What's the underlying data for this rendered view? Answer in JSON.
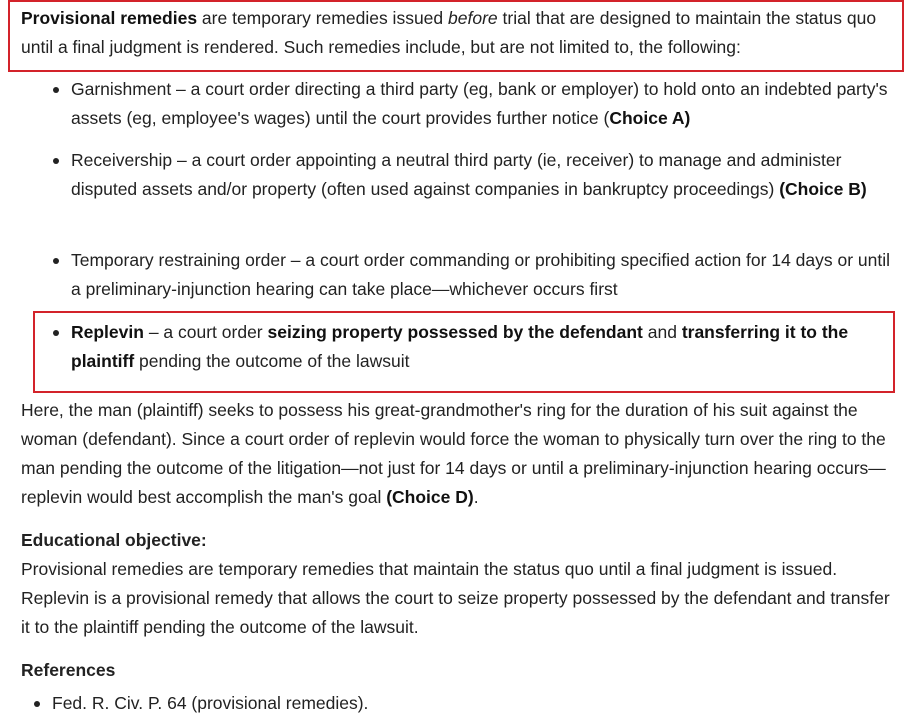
{
  "colors": {
    "highlight_box": "#d3232a",
    "text": "#222222"
  },
  "intro": {
    "term": "Provisional remedies",
    "text1": " are temporary remedies issued ",
    "emph": "before",
    "text2": " trial that are designed to maintain the status quo until a final judgment is rendered.  Such remedies include, but are not limited to, the following:"
  },
  "remedies": [
    {
      "text": "Garnishment – a court order directing a third party (eg, bank or employer) to hold onto an indebted party's assets (eg, employee's wages) until the court provides further notice (",
      "choice": "Choice A)"
    },
    {
      "text": "Receivership – a court order appointing a neutral third party (ie, receiver) to manage and administer disputed assets and/or property (often used against companies in bankruptcy proceedings) ",
      "choice": "(Choice B)"
    },
    {
      "text": "Temporary restraining order – a court order commanding or prohibiting specified action for 14 days or until a preliminary-injunction hearing can take place—whichever occurs first"
    },
    {
      "term": "Replevin",
      "text1": " – a court order ",
      "bold1": "seizing property possessed by the defendant",
      "text2": " and ",
      "bold2": "transferring it to the plaintiff",
      "text3": " pending the outcome of the lawsuit"
    }
  ],
  "explanation": {
    "text": "Here, the man (plaintiff) seeks to possess his great-grandmother's ring for the duration of his suit against the woman (defendant).  Since a court order of replevin would force the woman to physically turn over the ring to the man pending the outcome of the litigation—not just for 14 days or until a preliminary-injunction hearing occurs—replevin would best accomplish the man's goal ",
    "choice": "(Choice D)",
    "end": "."
  },
  "educational_objective": {
    "heading": "Educational objective:",
    "text": "Provisional remedies are temporary remedies that maintain the status quo until a final judgment is issued.  Replevin is a provisional remedy that allows the court to seize property possessed by the defendant and transfer it to the plaintiff pending the outcome of the lawsuit."
  },
  "references": {
    "heading": "References",
    "items": [
      "Fed. R. Civ. P. 64 (provisional remedies)."
    ]
  }
}
